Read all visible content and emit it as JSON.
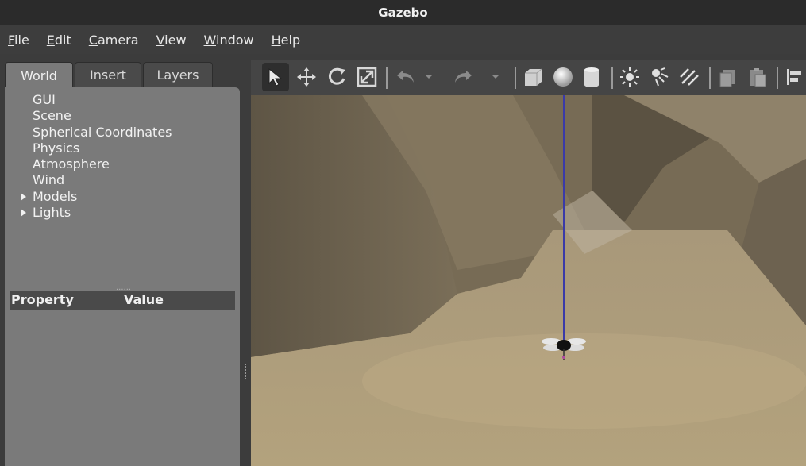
{
  "window": {
    "title": "Gazebo"
  },
  "menu": [
    {
      "key": "F",
      "rest": "ile"
    },
    {
      "key": "E",
      "rest": "dit"
    },
    {
      "key": "C",
      "rest": "amera"
    },
    {
      "key": "V",
      "rest": "iew"
    },
    {
      "key": "W",
      "rest": "indow"
    },
    {
      "key": "H",
      "rest": "elp"
    }
  ],
  "tabs": [
    {
      "label": "World",
      "active": true
    },
    {
      "label": "Insert",
      "active": false
    },
    {
      "label": "Layers",
      "active": false
    }
  ],
  "tree": [
    {
      "label": "GUI",
      "expandable": false
    },
    {
      "label": "Scene",
      "expandable": false
    },
    {
      "label": "Spherical Coordinates",
      "expandable": false
    },
    {
      "label": "Physics",
      "expandable": false
    },
    {
      "label": "Atmosphere",
      "expandable": false
    },
    {
      "label": "Wind",
      "expandable": false
    },
    {
      "label": "Models",
      "expandable": true
    },
    {
      "label": "Lights",
      "expandable": true
    }
  ],
  "splitter_dots": "......",
  "properties": {
    "col_property": "Property",
    "col_value": "Value"
  },
  "toolbar_icons": [
    "select-arrow",
    "translate",
    "rotate",
    "scale",
    "undo",
    "undo-dropdown",
    "redo",
    "redo-dropdown",
    "box",
    "sphere",
    "cylinder",
    "point-light",
    "spot-light",
    "directional-light",
    "copy",
    "paste",
    "align"
  ],
  "colors": {
    "panel": "#7a7a7a",
    "titlebar": "#2b2b2b",
    "z_axis": "#3a3aa8"
  }
}
